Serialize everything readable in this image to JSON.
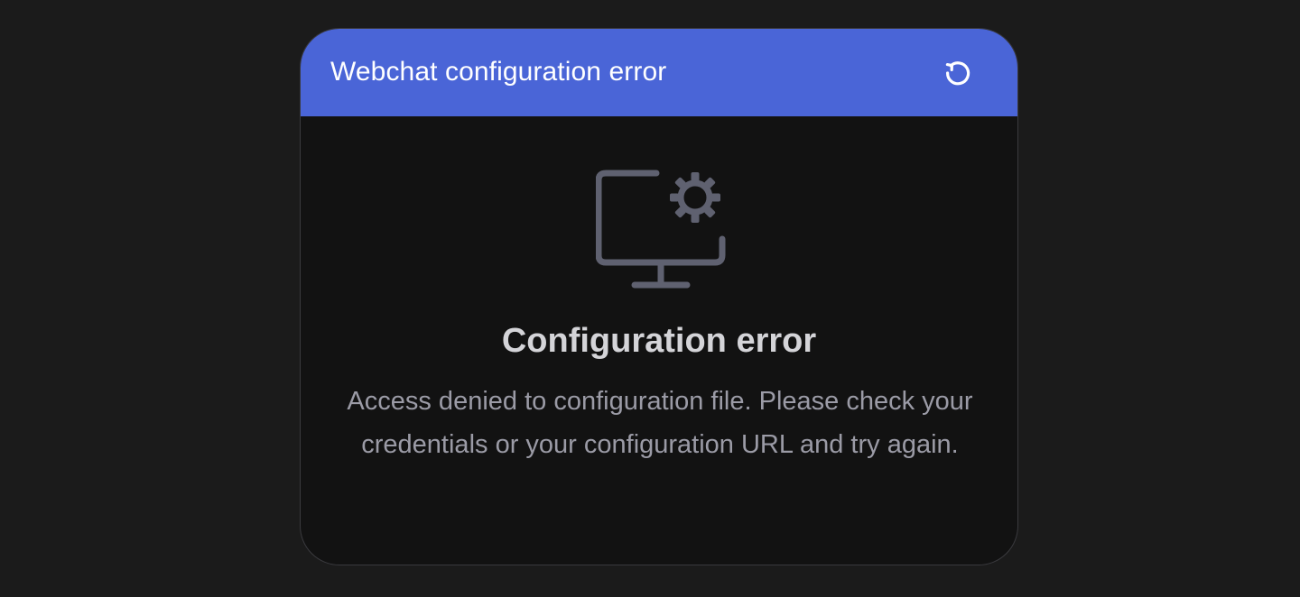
{
  "header": {
    "title": "Webchat configuration error",
    "background_color": "#4a65d7",
    "refresh_icon": "refresh-icon"
  },
  "body": {
    "illustration_icon": "monitor-settings-icon",
    "error_title": "Configuration error",
    "error_message": "Access denied to configuration file. Please check your credentials or your configuration URL and try again."
  },
  "colors": {
    "page_background": "#1b1b1b",
    "panel_background": "#121212",
    "icon_stroke": "#5f6170",
    "title_text": "#d4d4d8",
    "message_text": "#9b9ba6"
  }
}
